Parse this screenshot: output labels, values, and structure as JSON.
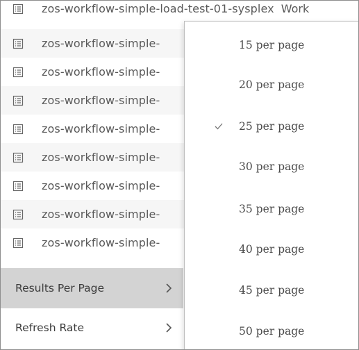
{
  "rows": [
    {
      "label": "zos-workflow-simple-load-test-01-sysplex",
      "suffix": "Work"
    },
    {
      "label": "zos-workflow-simple-"
    },
    {
      "label": "zos-workflow-simple-"
    },
    {
      "label": "zos-workflow-simple-"
    },
    {
      "label": "zos-workflow-simple-"
    },
    {
      "label": "zos-workflow-simple-"
    },
    {
      "label": "zos-workflow-simple-"
    },
    {
      "label": "zos-workflow-simple-"
    },
    {
      "label": "zos-workflow-simple-"
    }
  ],
  "menu": {
    "results_per_page": "Results Per Page",
    "refresh_rate": "Refresh Rate"
  },
  "per_page_options": [
    {
      "label": "15 per page",
      "selected": false
    },
    {
      "label": "20 per page",
      "selected": false
    },
    {
      "label": "25 per page",
      "selected": true
    },
    {
      "label": "30 per page",
      "selected": false
    },
    {
      "label": "35 per page",
      "selected": false
    },
    {
      "label": "40 per page",
      "selected": false
    },
    {
      "label": "45 per page",
      "selected": false
    },
    {
      "label": "50 per page",
      "selected": false
    }
  ],
  "colors": {
    "active_menu_bg": "#d3d3d3",
    "alt_row_bg": "#f6f6f6"
  },
  "icons": {
    "row_icon": "list-document-icon",
    "chevron": "chevron-right-icon",
    "check": "checkmark-icon"
  }
}
